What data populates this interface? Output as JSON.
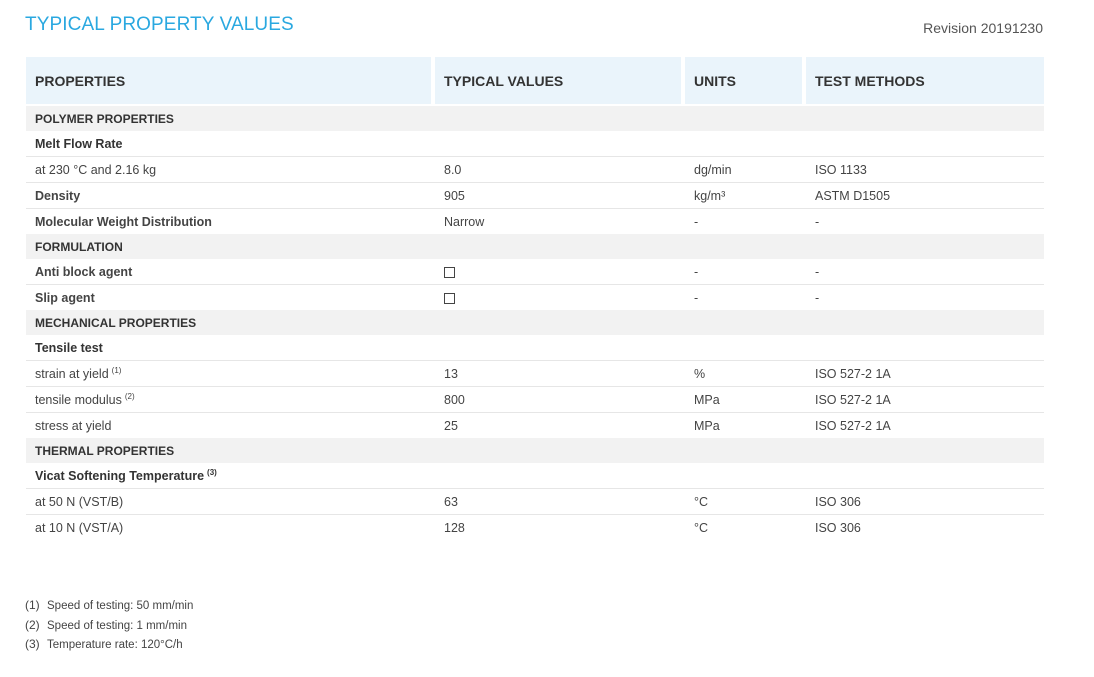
{
  "header": {
    "title": "TYPICAL PROPERTY VALUES",
    "revision": "Revision 20191230"
  },
  "table": {
    "columns": [
      "PROPERTIES",
      "TYPICAL VALUES",
      "UNITS",
      "TEST METHODS"
    ],
    "sections": [
      {
        "title": "POLYMER PROPERTIES",
        "group": "Melt Flow Rate",
        "rows": [
          {
            "property": "at 230 °C and 2.16 kg",
            "value": "8.0",
            "unit": "dg/min",
            "method": "ISO 1133",
            "bold": false
          },
          {
            "property": "Density",
            "value": "905",
            "unit": "kg/m³",
            "method": "ASTM D1505",
            "bold": true
          },
          {
            "property": "Molecular Weight Distribution",
            "value": "Narrow",
            "unit": "-",
            "method": "-",
            "bold": true
          }
        ]
      },
      {
        "title": "FORMULATION",
        "rows": [
          {
            "property": "Anti block agent",
            "checkbox": true,
            "unit": "-",
            "method": "-",
            "bold": true
          },
          {
            "property": "Slip agent",
            "checkbox": true,
            "unit": "-",
            "method": "-",
            "bold": true
          }
        ]
      },
      {
        "title": "MECHANICAL PROPERTIES",
        "group": "Tensile test",
        "rows": [
          {
            "property": "strain at yield",
            "note": "(1)",
            "value": "13",
            "unit": "%",
            "method": "ISO 527-2 1A",
            "bold": false
          },
          {
            "property": "tensile modulus",
            "note": "(2)",
            "value": "800",
            "unit": "MPa",
            "method": "ISO 527-2 1A",
            "bold": false
          },
          {
            "property": "stress at yield",
            "value": "25",
            "unit": "MPa",
            "method": "ISO 527-2 1A",
            "bold": false
          }
        ]
      },
      {
        "title": "THERMAL PROPERTIES",
        "group": "Vicat Softening Temperature",
        "group_note": "(3)",
        "rows": [
          {
            "property": "at 50 N (VST/B)",
            "value": "63",
            "unit": "°C",
            "method": "ISO 306",
            "bold": false
          },
          {
            "property": "at 10 N (VST/A)",
            "value": "128",
            "unit": "°C",
            "method": "ISO 306",
            "bold": false
          }
        ]
      }
    ]
  },
  "footnotes": [
    {
      "mark": "(1)",
      "text": "Speed of testing: 50 mm/min"
    },
    {
      "mark": "(2)",
      "text": "Speed of testing: 1 mm/min"
    },
    {
      "mark": "(3)",
      "text": "Temperature rate: 120°C/h"
    }
  ]
}
